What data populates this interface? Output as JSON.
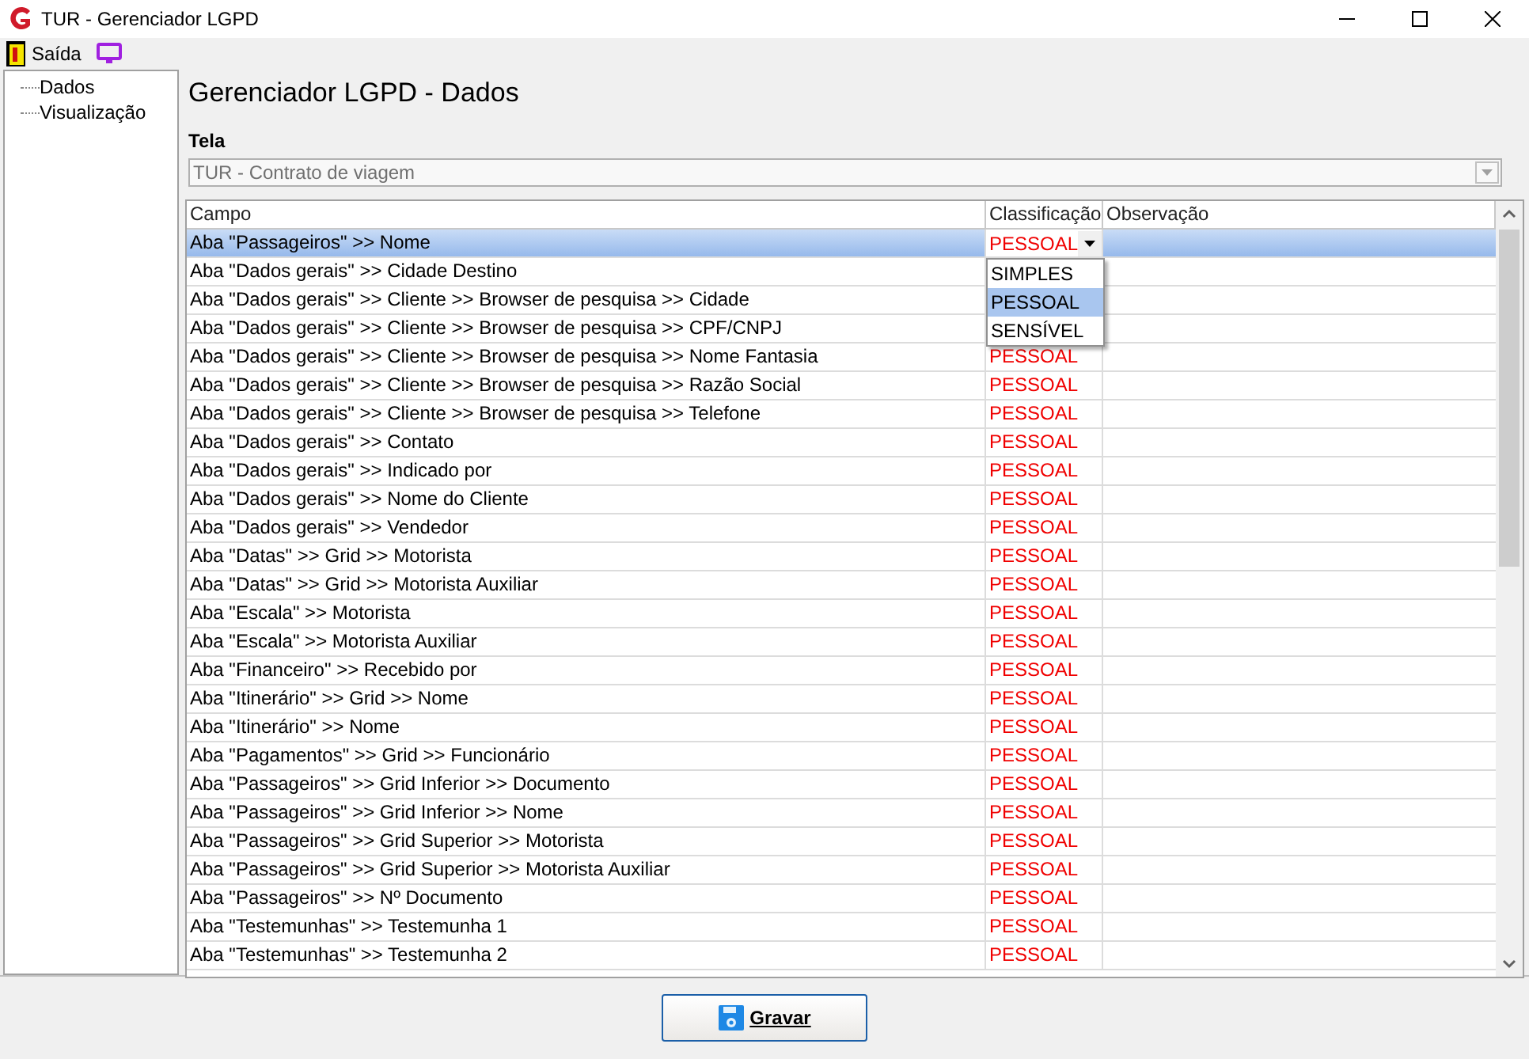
{
  "window": {
    "title": "TUR - Gerenciador LGPD"
  },
  "toolbar": [
    {
      "kind": "exit",
      "label": "Saída"
    },
    {
      "kind": "monitor"
    }
  ],
  "tree": {
    "items": [
      {
        "label": "Dados"
      },
      {
        "label": "Visualização"
      }
    ]
  },
  "heading": "Gerenciador LGPD - Dados",
  "tela": {
    "label": "Tela",
    "value": "TUR - Contrato de viagem"
  },
  "table": {
    "columns": [
      "Campo",
      "Classificação",
      "Observação"
    ],
    "editor": {
      "value": "PESSOAL",
      "options": [
        {
          "label": "SIMPLES",
          "selected": false
        },
        {
          "label": "PESSOAL",
          "selected": true
        },
        {
          "label": "SENSÍVEL",
          "selected": false
        }
      ]
    },
    "rows": [
      {
        "campo": "Aba \"Passageiros\" >> Nome",
        "selected": true
      },
      {
        "campo": "Aba \"Dados gerais\" >> Cidade Destino",
        "selected": false
      },
      {
        "campo": "Aba \"Dados gerais\" >> Cliente >> Browser de pesquisa >> Cidade",
        "selected": false
      },
      {
        "campo": "Aba \"Dados gerais\" >> Cliente >> Browser de pesquisa >> CPF/CNPJ",
        "selected": false
      },
      {
        "campo": "Aba \"Dados gerais\" >> Cliente >> Browser de pesquisa >> Nome Fantasia",
        "classificacao": "PESSOAL",
        "selected": false
      },
      {
        "campo": "Aba \"Dados gerais\" >> Cliente >> Browser de pesquisa >> Razão Social",
        "classificacao": "PESSOAL",
        "selected": false
      },
      {
        "campo": "Aba \"Dados gerais\" >> Cliente >> Browser de pesquisa >> Telefone",
        "classificacao": "PESSOAL",
        "selected": false
      },
      {
        "campo": "Aba \"Dados gerais\" >> Contato",
        "classificacao": "PESSOAL",
        "selected": false
      },
      {
        "campo": "Aba \"Dados gerais\" >> Indicado por",
        "classificacao": "PESSOAL",
        "selected": false
      },
      {
        "campo": "Aba \"Dados gerais\" >> Nome do Cliente",
        "classificacao": "PESSOAL",
        "selected": false
      },
      {
        "campo": "Aba \"Dados gerais\" >> Vendedor",
        "classificacao": "PESSOAL",
        "selected": false
      },
      {
        "campo": "Aba \"Datas\" >> Grid >> Motorista",
        "classificacao": "PESSOAL",
        "selected": false
      },
      {
        "campo": "Aba \"Datas\" >> Grid >> Motorista Auxiliar",
        "classificacao": "PESSOAL",
        "selected": false
      },
      {
        "campo": "Aba \"Escala\" >> Motorista",
        "classificacao": "PESSOAL",
        "selected": false
      },
      {
        "campo": "Aba \"Escala\" >> Motorista Auxiliar",
        "classificacao": "PESSOAL",
        "selected": false
      },
      {
        "campo": "Aba \"Financeiro\" >> Recebido por",
        "classificacao": "PESSOAL",
        "selected": false
      },
      {
        "campo": "Aba \"Itinerário\" >> Grid >> Nome",
        "classificacao": "PESSOAL",
        "selected": false
      },
      {
        "campo": "Aba \"Itinerário\" >> Nome",
        "classificacao": "PESSOAL",
        "selected": false
      },
      {
        "campo": "Aba \"Pagamentos\" >> Grid >> Funcionário",
        "classificacao": "PESSOAL",
        "selected": false
      },
      {
        "campo": "Aba \"Passageiros\" >> Grid Inferior >> Documento",
        "classificacao": "PESSOAL",
        "selected": false
      },
      {
        "campo": "Aba \"Passageiros\" >> Grid Inferior >> Nome",
        "classificacao": "PESSOAL",
        "selected": false
      },
      {
        "campo": "Aba \"Passageiros\" >> Grid Superior >> Motorista",
        "classificacao": "PESSOAL",
        "selected": false
      },
      {
        "campo": "Aba \"Passageiros\" >> Grid Superior >> Motorista Auxiliar",
        "classificacao": "PESSOAL",
        "selected": false
      },
      {
        "campo": "Aba \"Passageiros\" >> Nº Documento",
        "classificacao": "PESSOAL",
        "selected": false
      },
      {
        "campo": "Aba \"Testemunhas\" >> Testemunha 1",
        "classificacao": "PESSOAL",
        "selected": false
      },
      {
        "campo": "Aba \"Testemunhas\" >> Testemunha 2",
        "classificacao": "PESSOAL",
        "selected": false
      }
    ]
  },
  "save_button": {
    "label": "Gravar"
  }
}
